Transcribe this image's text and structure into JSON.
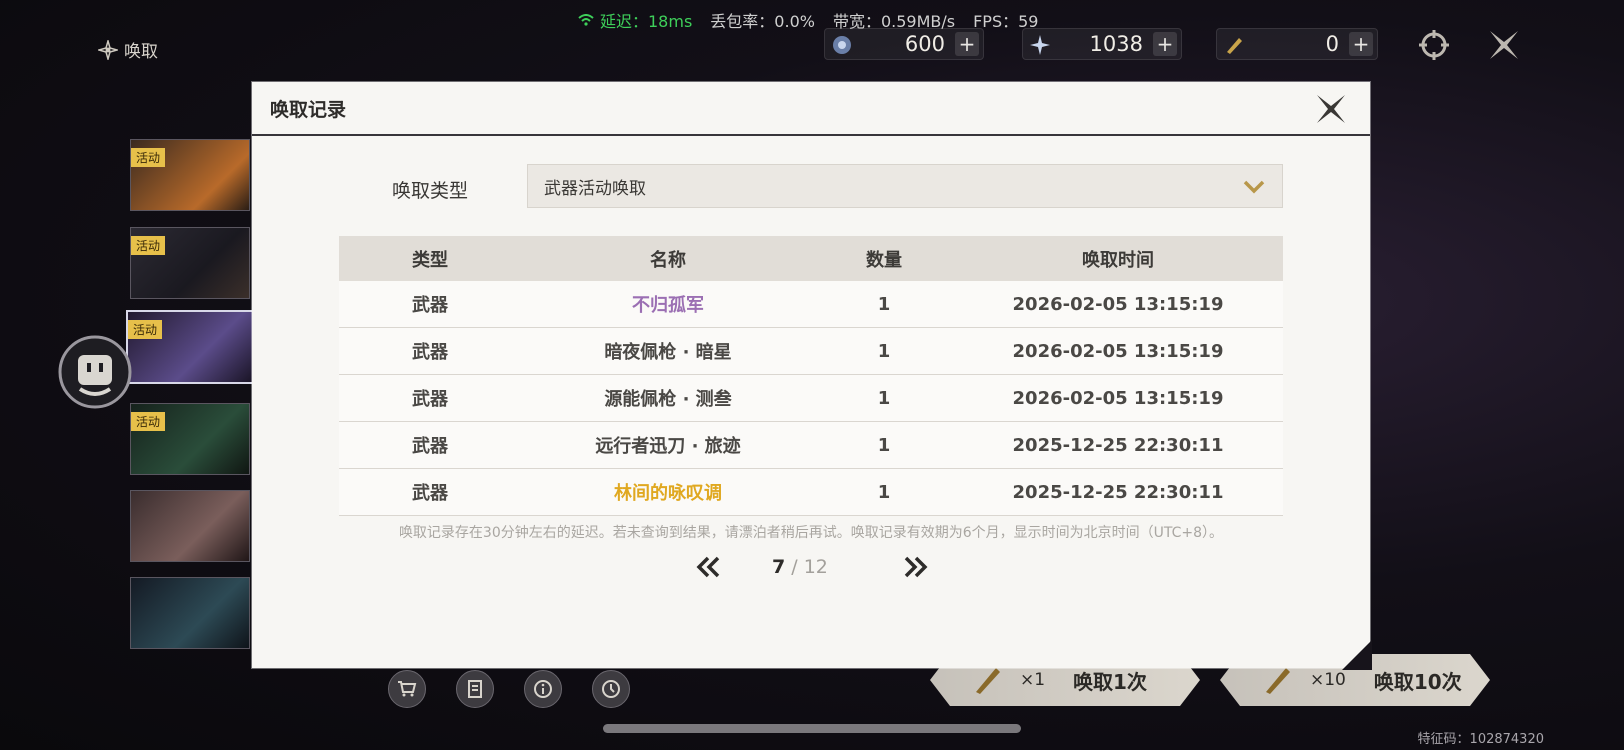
{
  "status": {
    "latency": "延迟：18ms",
    "packet_loss": "丢包率：0.0%",
    "bandwidth": "带宽：0.59MB/s",
    "fps": "FPS：59",
    "latency_color": "#3ecf5a"
  },
  "page_label": "唤取",
  "currencies": [
    {
      "icon": "lunite-icon",
      "amount": "600"
    },
    {
      "icon": "astrite-icon",
      "amount": "1038"
    },
    {
      "icon": "forging-tide-icon",
      "amount": "0"
    }
  ],
  "side_tags": [
    "活动",
    "活动",
    "活动",
    "活动"
  ],
  "summon": {
    "single_mult": "×1",
    "single_label": "唤取1次",
    "ten_mult": "×10",
    "ten_label": "唤取10次"
  },
  "feature_code": "特征码：102874320",
  "modal": {
    "title": "唤取记录",
    "type_label": "唤取类型",
    "type_value": "武器活动唤取",
    "columns": [
      "类型",
      "名称",
      "数量",
      "唤取时间"
    ],
    "rows": [
      {
        "kind": "武器",
        "name": "不归孤军",
        "qty": "1",
        "time": "2026-02-05 13:15:19"
      },
      {
        "kind": "武器",
        "name": "暗夜佩枪 · 暗星",
        "qty": "1",
        "time": "2026-02-05 13:15:19"
      },
      {
        "kind": "武器",
        "name": "源能佩枪 · 测叁",
        "qty": "1",
        "time": "2026-02-05 13:15:19"
      },
      {
        "kind": "武器",
        "name": "远行者迅刀 · 旅迹",
        "qty": "1",
        "time": "2025-12-25 22:30:11"
      },
      {
        "kind": "武器",
        "name": "林间的咏叹调",
        "qty": "1",
        "time": "2025-12-25 22:30:11"
      }
    ],
    "rarity_colors": {
      "4star": "#9b6fb3",
      "5star": "#e0a820",
      "3star": "#4a4845"
    },
    "notice": "唤取记录存在30分钟左右的延迟。若未查询到结果，请漂泊者稍后再试。唤取记录有效期为6个月，显示时间为北京时间（UTC+8）。",
    "pager": {
      "current": "7",
      "separator": " / ",
      "total": "12"
    }
  }
}
